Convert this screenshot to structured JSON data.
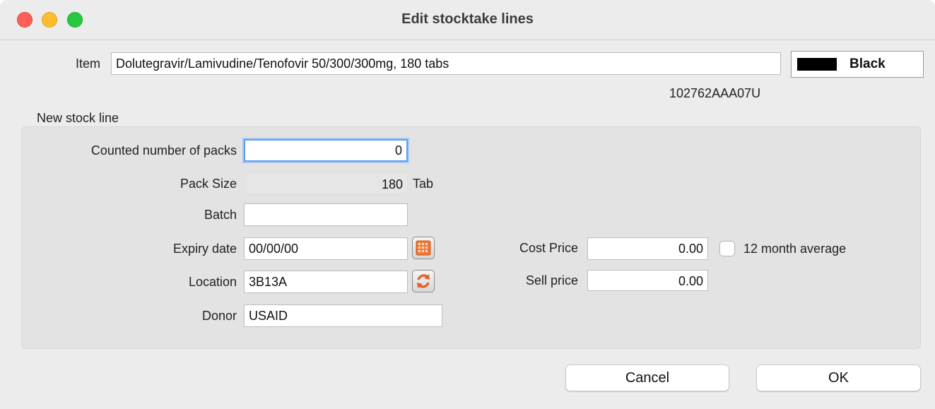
{
  "window": {
    "title": "Edit stocktake lines"
  },
  "item": {
    "label": "Item",
    "value": "Dolutegravir/Lamivudine/Tenofovir 50/300/300mg, 180 tabs",
    "code": "102762AAA07U",
    "color_name": "Black",
    "color_hex": "#000000"
  },
  "section": {
    "title": "New stock line"
  },
  "form": {
    "counted_label": "Counted number of packs",
    "counted_value": "0",
    "pack_size_label": "Pack Size",
    "pack_size_value": "180",
    "pack_unit": "Tab",
    "batch_label": "Batch",
    "batch_value": "",
    "expiry_label": "Expiry date",
    "expiry_value": "00/00/00",
    "location_label": "Location",
    "location_value": "3B13A",
    "donor_label": "Donor",
    "donor_value": "USAID",
    "cost_label": "Cost Price",
    "cost_value": "0.00",
    "average_label": "12 month average",
    "average_checked": false,
    "sell_label": "Sell price",
    "sell_value": "0.00"
  },
  "buttons": {
    "cancel": "Cancel",
    "ok": "OK"
  },
  "icons": {
    "calendar": "calendar-icon",
    "location_refresh": "refresh-icon"
  }
}
